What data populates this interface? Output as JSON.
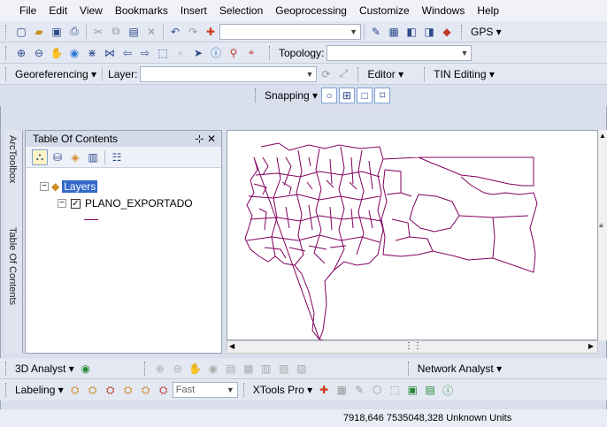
{
  "menu": [
    "File",
    "Edit",
    "View",
    "Bookmarks",
    "Insert",
    "Selection",
    "Geoprocessing",
    "Customize",
    "Windows",
    "Help"
  ],
  "toolbar2": {
    "gps_label": "GPS ▾"
  },
  "toolbar3": {
    "topology_label": "Topology:"
  },
  "toolbar4": {
    "georef_label": "Georeferencing ▾",
    "layer_label": "Layer:",
    "editor_label": "Editor ▾",
    "tin_label": "TIN Editing ▾"
  },
  "toolbar5": {
    "snapping_label": "Snapping ▾"
  },
  "toc": {
    "title": "Table Of Contents",
    "layers_label": "Layers",
    "layer_name": "PLANO_EXPORTADO"
  },
  "side_tabs": {
    "arctoolbox": "ArcToolbox",
    "toc": "Table Of Contents"
  },
  "bottom_toolbar1": {
    "analyst3d": "3D Analyst ▾",
    "network": "Network Analyst ▾"
  },
  "bottom_toolbar2": {
    "labeling": "Labeling ▾",
    "fast": "Fast",
    "xtools": "XTools Pro ▾"
  },
  "status": {
    "coords": "7918,646  7535048,328 Unknown Units"
  },
  "colors": {
    "polygon_stroke": "#800060",
    "highlight": "#3369c9"
  }
}
